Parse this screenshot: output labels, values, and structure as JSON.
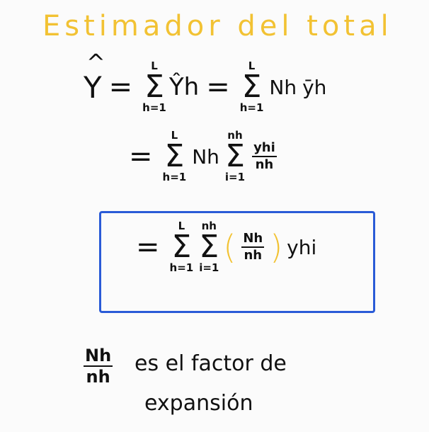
{
  "title": "Estimador del total",
  "symbols": {
    "Y": "Y",
    "hat": "^",
    "eq": "=",
    "sigma": "Σ",
    "upper_L": "L",
    "lower_h1": "h=1",
    "upper_nh": "nh",
    "lower_i1": "i=1",
    "Yh": "Ŷh",
    "Nh": "Nh",
    "ybar_h": "ȳh",
    "y_hi": "yhi",
    "n_h": "nh",
    "lparen": "(",
    "rparen": ")"
  },
  "note": {
    "frac_num": "Nh",
    "frac_den": "nh",
    "line1": "es el factor de",
    "line2": "expansión"
  },
  "colors": {
    "title": "#f2c233",
    "box": "#2a5bd7",
    "ink": "#111111"
  }
}
